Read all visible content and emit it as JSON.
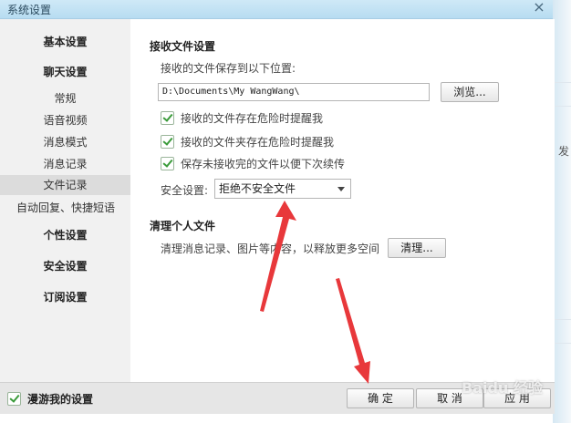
{
  "window": {
    "title": "系统设置",
    "close_label": "×"
  },
  "sidebar": {
    "items": [
      {
        "label": "基本设置"
      },
      {
        "label": "聊天设置"
      },
      {
        "label": "常规"
      },
      {
        "label": "语音视频"
      },
      {
        "label": "消息模式"
      },
      {
        "label": "消息记录"
      },
      {
        "label": "文件记录"
      },
      {
        "label": "自动回复、快捷短语"
      },
      {
        "label": "个性设置"
      },
      {
        "label": "安全设置"
      },
      {
        "label": "订阅设置"
      }
    ]
  },
  "receive": {
    "title": "接收文件设置",
    "save_location_label": "接收的文件保存到以下位置:",
    "path_value": "D:\\Documents\\My WangWang\\",
    "browse_label": "浏览...",
    "checks": [
      {
        "label": "接收的文件存在危险时提醒我",
        "checked": true
      },
      {
        "label": "接收的文件夹存在危险时提醒我",
        "checked": true
      },
      {
        "label": "保存未接收完的文件以便下次续传",
        "checked": true
      }
    ],
    "security_label": "安全设置:",
    "security_value": "拒绝不安全文件"
  },
  "clean": {
    "title": "清理个人文件",
    "desc": "清理消息记录、图片等内容，以释放更多空间",
    "clean_label": "清理..."
  },
  "footer": {
    "roam_label": "漫游我的设置",
    "ok_label": "确 定",
    "cancel_label": "取 消",
    "apply_label": "应 用"
  },
  "background": {
    "side_text": "发"
  },
  "watermark": {
    "text": "Baidu 经验"
  },
  "colors": {
    "arrow": "#e8383b",
    "checkmark": "#3a9b3a",
    "titlebar": "#c4e3f5"
  }
}
